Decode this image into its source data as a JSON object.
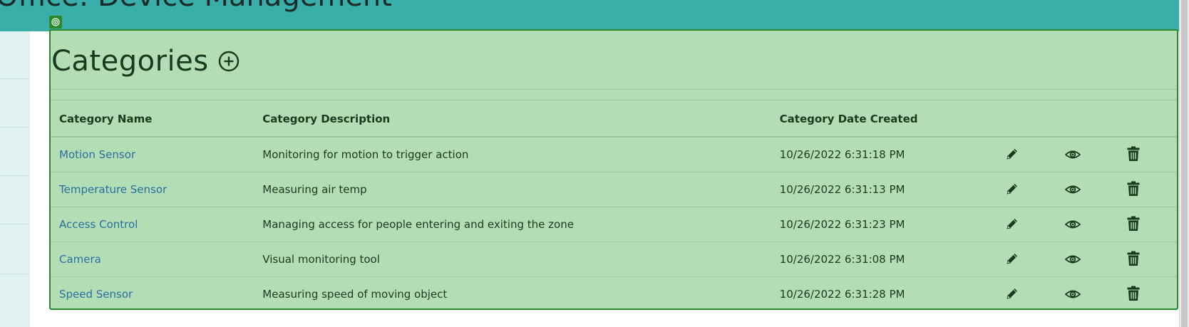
{
  "header": {
    "app_title": "Office: Device Management"
  },
  "panel": {
    "title": "Categories",
    "add_icon": "plus-circle-icon"
  },
  "table": {
    "columns": [
      "Category Name",
      "Category Description",
      "Category Date Created",
      "",
      "",
      ""
    ],
    "rows": [
      {
        "name": "Motion Sensor",
        "description": "Monitoring for motion to trigger action",
        "created": "10/26/2022 6:31:18 PM"
      },
      {
        "name": "Temperature Sensor",
        "description": "Measuring air temp",
        "created": "10/26/2022 6:31:13 PM"
      },
      {
        "name": "Access Control",
        "description": "Managing access for people entering and exiting the zone",
        "created": "10/26/2022 6:31:23 PM"
      },
      {
        "name": "Camera",
        "description": "Visual monitoring tool",
        "created": "10/26/2022 6:31:08 PM"
      },
      {
        "name": "Speed Sensor",
        "description": "Measuring speed of moving object",
        "created": "10/26/2022 6:31:28 PM"
      }
    ],
    "row_actions": [
      "pencil-icon",
      "eye-icon",
      "trash-icon"
    ]
  },
  "colors": {
    "header_bg": "#3aaea8",
    "panel_bg": "#b3ddb5",
    "panel_border": "#2a8a2a",
    "link": "#2a6fa0",
    "text": "#1a3a1f"
  }
}
